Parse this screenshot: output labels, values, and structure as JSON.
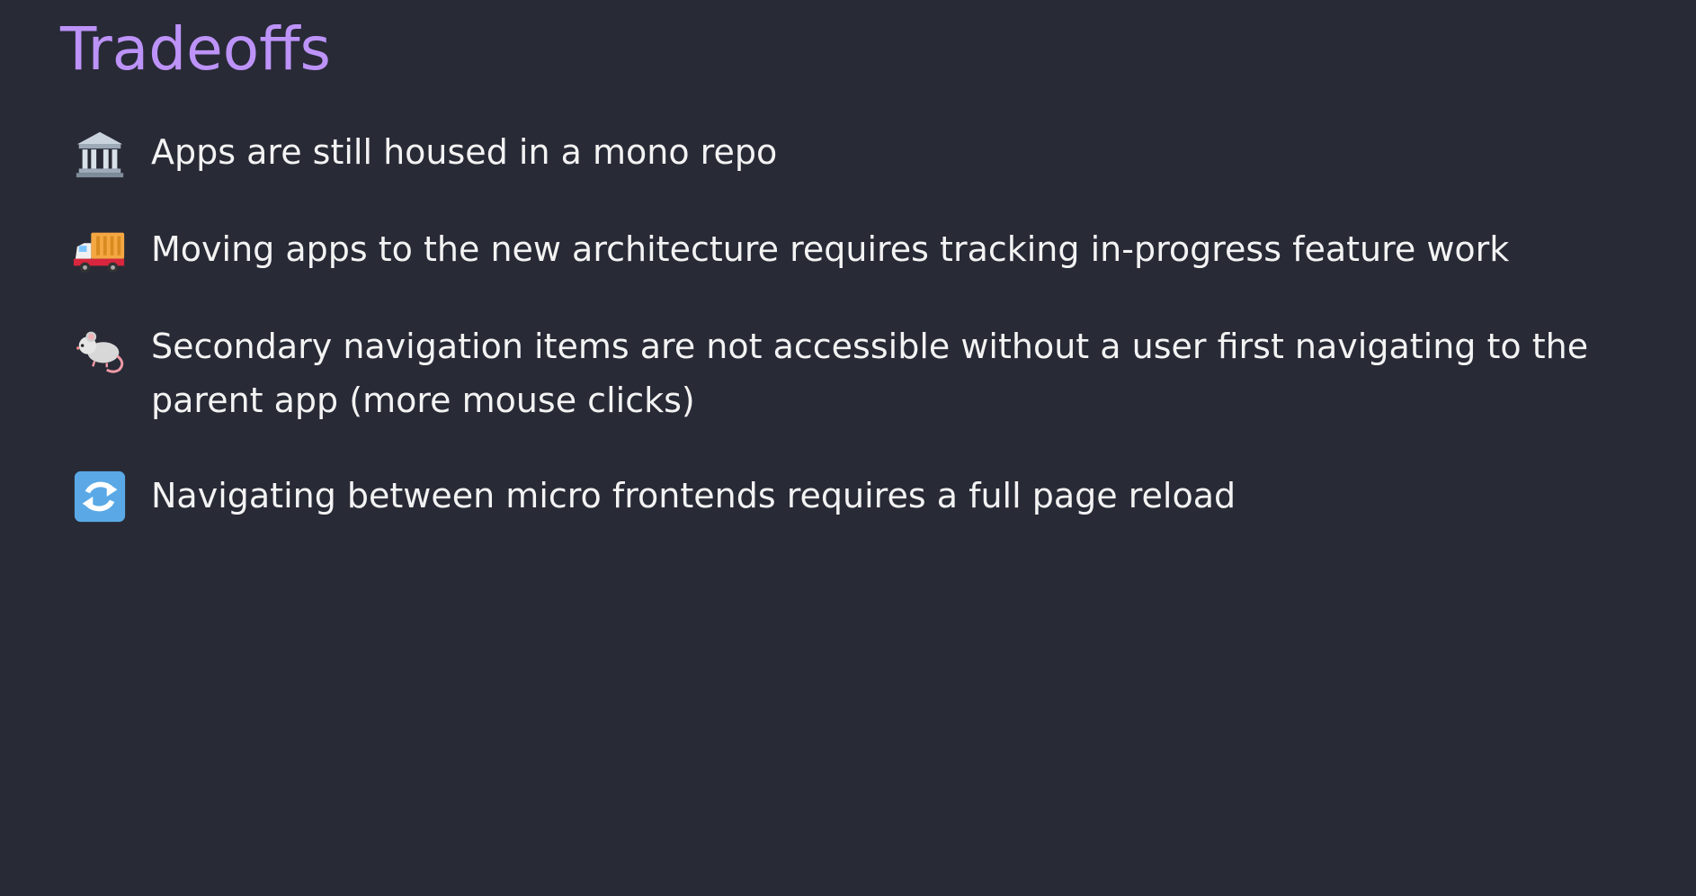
{
  "slide": {
    "title": "Tradeoffs",
    "items": [
      {
        "icon": "classical-building-icon",
        "text": "Apps are still housed in a mono repo"
      },
      {
        "icon": "delivery-truck-icon",
        "text": "Moving apps to the new architecture requires tracking in-progress feature work"
      },
      {
        "icon": "mouse-icon",
        "text": "Secondary navigation items are not accessible without a user first navigating to the parent app (more mouse clicks)"
      },
      {
        "icon": "counterclockwise-arrows-icon",
        "text": "Navigating between micro frontends requires a full page reload"
      }
    ]
  },
  "colors": {
    "background": "#282a36",
    "title": "#bd93f9",
    "text": "#f3f3f3"
  }
}
